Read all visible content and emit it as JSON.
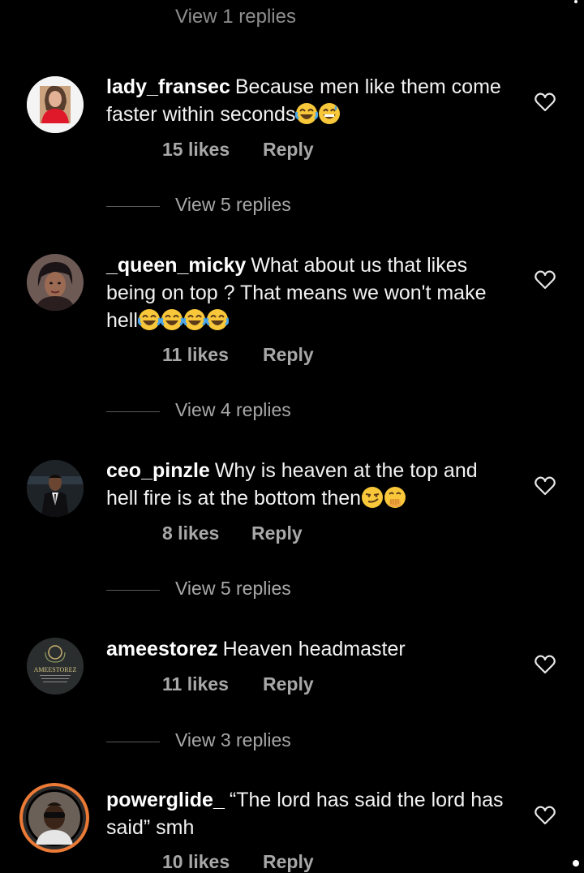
{
  "top_partial": "View 1 replies",
  "comments": [
    {
      "username": "lady_fransec",
      "text": "Because men like them come faster within seconds",
      "emojis": [
        "laughing",
        "grinning-sweat"
      ],
      "likes": "15 likes",
      "reply": "Reply",
      "view_replies": "View 5 replies"
    },
    {
      "username": "_queen_micky",
      "text": "What about us that likes being on top ?  That means we won't make hell",
      "emojis": [
        "laughing",
        "laughing",
        "laughing",
        "laughing"
      ],
      "likes": "11 likes",
      "reply": "Reply",
      "view_replies": "View 4 replies"
    },
    {
      "username": "ceo_pinzle",
      "text": "Why is heaven at the top and hell fire is at the bottom then",
      "emojis": [
        "smirk",
        "hand-over-mouth"
      ],
      "likes": "8 likes",
      "reply": "Reply",
      "view_replies": "View 5 replies"
    },
    {
      "username": "ameestorez",
      "text": "Heaven headmaster",
      "emojis": [],
      "likes": "11 likes",
      "reply": "Reply",
      "view_replies": "View 3 replies",
      "avatar_text": "AMEESTOREZ"
    },
    {
      "username": "powerglide_",
      "text": "“The lord has said the lord has said” smh",
      "emojis": [],
      "likes": "10 likes",
      "reply": "Reply"
    }
  ],
  "colors": {
    "background": "#000000",
    "text": "#f2f2f2",
    "muted": "#a8a8a8",
    "story_ring": "#ea7a36"
  }
}
